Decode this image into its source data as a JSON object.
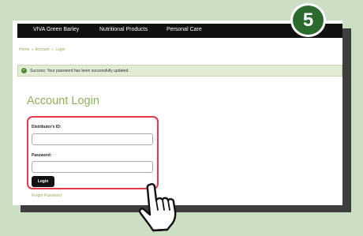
{
  "navbar": {
    "items": [
      "VIVA Green Barley",
      "Nutritional Products",
      "Personal Care"
    ]
  },
  "breadcrumb": {
    "items": [
      "Home",
      "Account",
      "Login"
    ],
    "separator": "»"
  },
  "alert": {
    "message": "Success: Your password has been successfully updated.",
    "icon": "check-circle-icon"
  },
  "page_title": "Account Login",
  "form": {
    "distributor_label": "Distributor's ID:",
    "distributor_value": "",
    "password_label": "Password:",
    "password_value": "",
    "login_label": "Login"
  },
  "forgot_password": "Forgot Password",
  "step_badge": "5",
  "colors": {
    "background": "#ccdfc4",
    "accent_green": "#8fb058",
    "highlight_red": "#e53a4a",
    "badge_green": "#2d6a2e"
  }
}
